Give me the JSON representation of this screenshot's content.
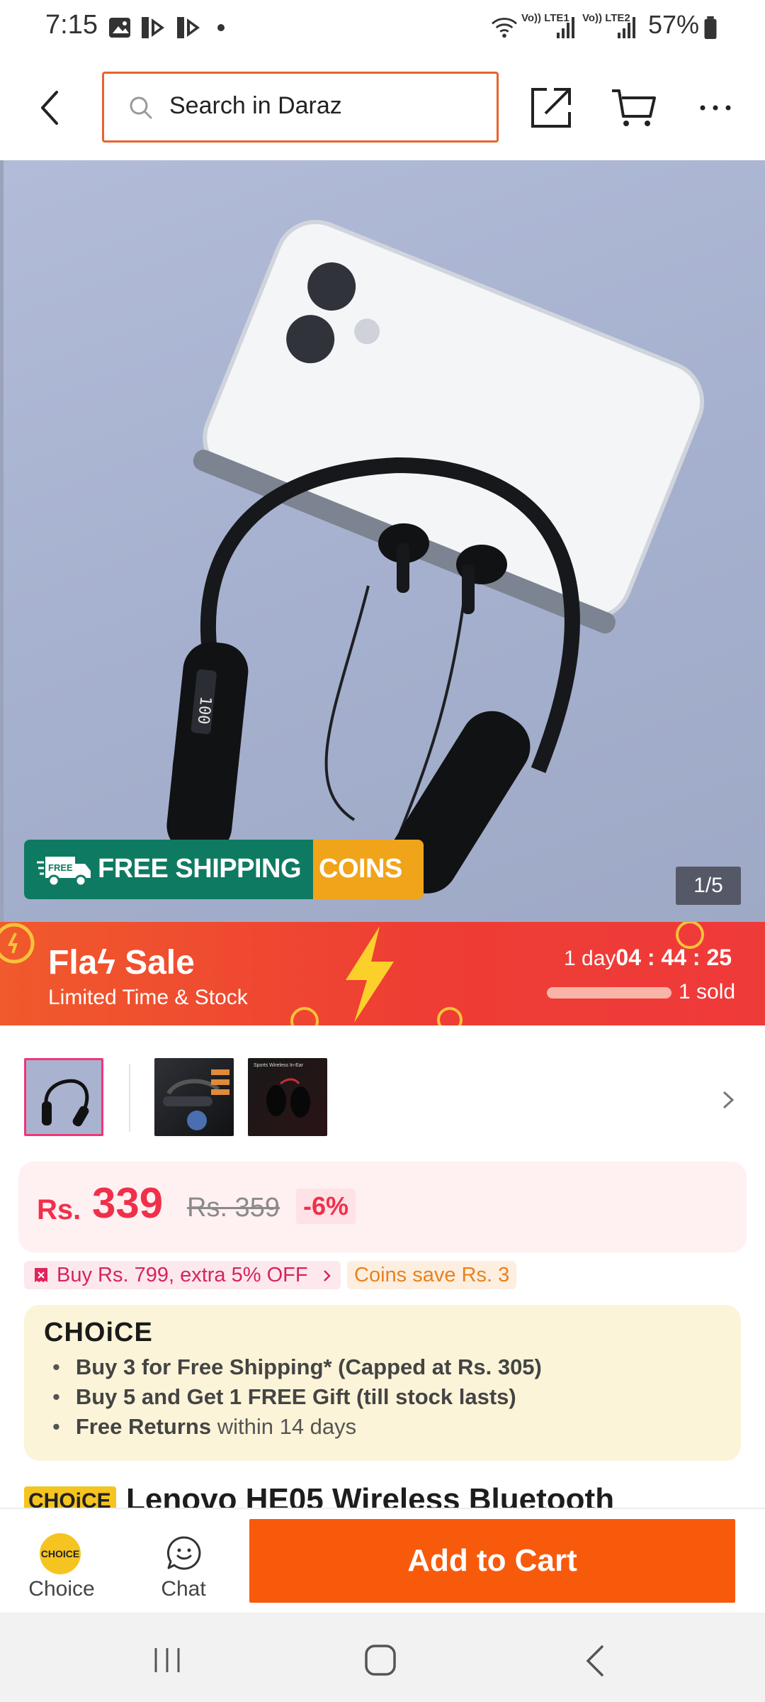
{
  "status_bar": {
    "time": "7:15",
    "network_1": "Vo)) LTE1",
    "network_2": "Vo)) LTE2",
    "battery": "57%"
  },
  "top_nav": {
    "search_placeholder": "Search in Daraz",
    "icons": [
      "back-arrow-icon",
      "search-icon",
      "share-icon",
      "cart-icon",
      "more-icon"
    ]
  },
  "hero": {
    "free_shipping_label": "FREE SHIPPING",
    "free_badge_label": "FREE",
    "coins_label": "COINS",
    "image_counter": "1/5",
    "current_image": 1,
    "total_images": 5
  },
  "flash_sale": {
    "title": "Flaϟ Sale",
    "subtitle": "Limited Time & Stock",
    "timer_days": "1 day",
    "timer_clock": "04 : 44 : 25",
    "sold": "1 sold"
  },
  "thumbnails": {
    "items": [
      "thumb-1",
      "thumb-2",
      "thumb-3"
    ],
    "thumb_3_caption": "Sports Wireless In-Ear",
    "selected_index": 0
  },
  "price": {
    "currency": "Rs.",
    "value": "339",
    "original": "Rs. 359",
    "discount": "-6%"
  },
  "promos": {
    "deal": "Buy Rs. 799, extra 5% OFF",
    "coins": "Coins save Rs. 3"
  },
  "choice": {
    "logo": "CHOiCE",
    "items": [
      {
        "bold": "Buy 3 for  Free Shipping* (Capped at Rs. 305)",
        "rest": ""
      },
      {
        "bold": "Buy 5 and Get 1 FREE Gift (till stock lasts)",
        "rest": ""
      },
      {
        "bold": "Free Returns",
        "rest": " within 14 days"
      }
    ]
  },
  "product": {
    "badge": "CHOiCE",
    "title": "Lenovo HE05 Wireless Bluetooth"
  },
  "bottom_bar": {
    "choice_label": "Choice",
    "choice_icon_text": "CHOICE",
    "chat_label": "Chat",
    "add_to_cart": "Add to Cart"
  },
  "colors": {
    "accent_orange": "#f85a0c",
    "search_border": "#e8642c",
    "price_red": "#f0304a",
    "flash_red": "#ee3d34",
    "shipping_green": "#0f7a62",
    "coins_yellow": "#f0a41a",
    "choice_yellow": "#f5c420"
  }
}
